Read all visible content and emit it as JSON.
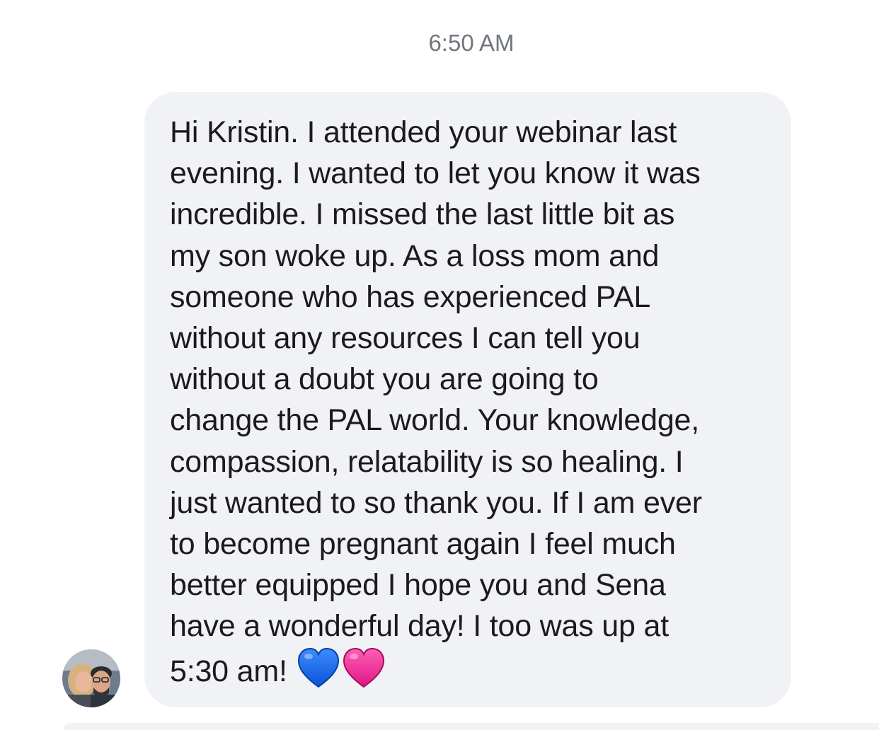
{
  "thread": {
    "timestamp": "6:50 AM"
  },
  "message": {
    "text": "Hi Kristin. I attended your webinar last\nevening. I wanted to let you know it was\nincredible. I missed the last little bit as\nmy son woke up. As a loss mom and\nsomeone who has experienced PAL\nwithout any resources I can tell you\nwithout a doubt you are going to\nchange the PAL world. Your knowledge,\ncompassion, relatability is so healing. I\njust wanted to so thank you. If I am ever\nto become pregnant again I feel much\nbetter equipped   I hope you and Sena\nhave a wonderful day!  I too was up at\n5:30 am! ",
    "emoji": [
      "blue-heart",
      "pink-heart"
    ],
    "bubble_color": "#f1f2f6",
    "text_color": "#1b1b1c"
  },
  "colors": {
    "blue_heart": "#1e6ff5",
    "pink_heart": "#f0349a",
    "timestamp": "#72767c"
  }
}
